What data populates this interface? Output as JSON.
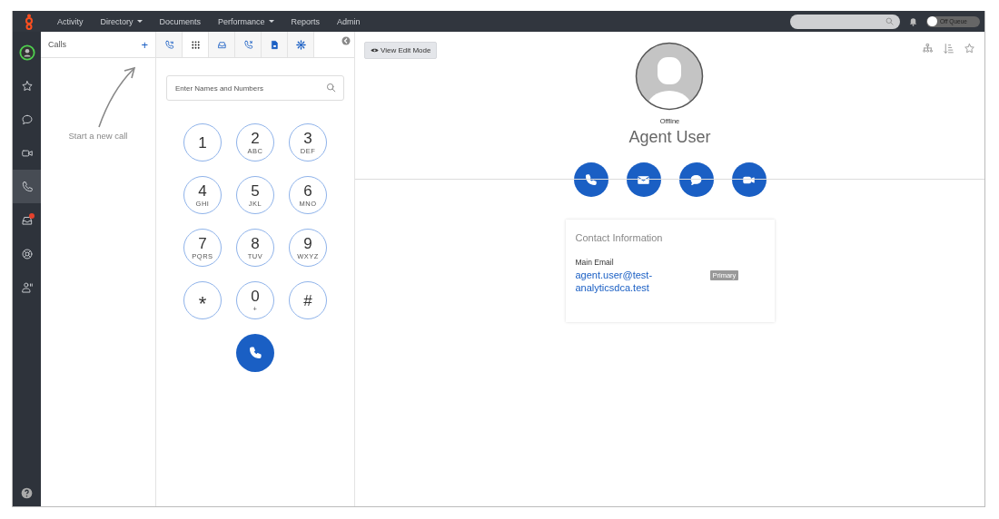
{
  "nav": [
    {
      "label": "Activity",
      "dropdown": false
    },
    {
      "label": "Directory",
      "dropdown": true
    },
    {
      "label": "Documents",
      "dropdown": false
    },
    {
      "label": "Performance",
      "dropdown": true
    },
    {
      "label": "Reports",
      "dropdown": false
    },
    {
      "label": "Admin",
      "dropdown": false
    }
  ],
  "queue_toggle": {
    "label": "Off Queue",
    "on": false
  },
  "rail": [
    {
      "kind": "status",
      "selected": false,
      "alert": false
    },
    {
      "kind": "star",
      "selected": false,
      "alert": false
    },
    {
      "kind": "chat",
      "selected": false,
      "alert": false
    },
    {
      "kind": "video",
      "selected": false,
      "alert": false
    },
    {
      "kind": "phone",
      "selected": true,
      "alert": false
    },
    {
      "kind": "inbox",
      "selected": false,
      "alert": true
    },
    {
      "kind": "lifebuoy",
      "selected": false,
      "alert": false
    },
    {
      "kind": "person",
      "selected": false,
      "alert": false
    },
    {
      "kind": "help",
      "selected": false,
      "alert": false
    }
  ],
  "calls_panel": {
    "title": "Calls",
    "add": "+",
    "hint": "Start a new call"
  },
  "dialer_tabs": [
    {
      "kind": "phone-list",
      "selected": false
    },
    {
      "kind": "dialpad",
      "selected": true
    },
    {
      "kind": "inbox",
      "selected": false
    },
    {
      "kind": "phone-back",
      "selected": false
    },
    {
      "kind": "document",
      "selected": false
    },
    {
      "kind": "gear",
      "selected": false
    }
  ],
  "dialer": {
    "placeholder": "Enter Names and Numbers",
    "keys": [
      {
        "digit": "1"
      },
      {
        "digit": "2",
        "letters": "ABC"
      },
      {
        "digit": "3",
        "letters": "DEF"
      },
      {
        "digit": "4",
        "letters": "GHI"
      },
      {
        "digit": "5",
        "letters": "JKL"
      },
      {
        "digit": "6",
        "letters": "MNO"
      },
      {
        "digit": "7",
        "letters": "PQRS"
      },
      {
        "digit": "8",
        "letters": "TUV"
      },
      {
        "digit": "9",
        "letters": "WXYZ"
      },
      {
        "digit": "*"
      },
      {
        "digit": "0",
        "letters": "+"
      },
      {
        "digit": "#"
      }
    ]
  },
  "profile": {
    "edit_button": "View Edit Mode",
    "status": "Offline",
    "name": "Agent User",
    "actions": [
      {
        "kind": "phone"
      },
      {
        "kind": "email"
      },
      {
        "kind": "chat"
      },
      {
        "kind": "video"
      }
    ],
    "contact_card": {
      "title": "Contact Information",
      "label": "Main Email",
      "email": "agent.user@test-analyticsdca.test",
      "badge": "Primary"
    }
  }
}
